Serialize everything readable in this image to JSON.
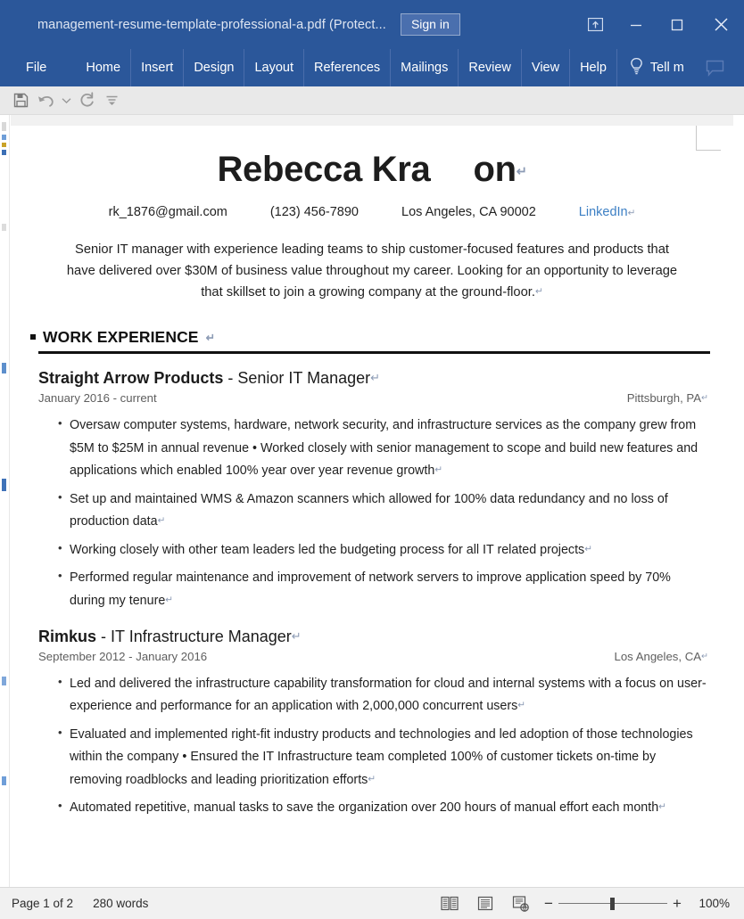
{
  "window": {
    "title": "management-resume-template-professional-a.pdf (Protect...",
    "sign_in_label": "Sign in",
    "accent_color": "#2b579a",
    "controls": {
      "ribbon_display_options": "ribbon-display-options-icon",
      "minimize": "minimize-icon",
      "maximize": "maximize-icon",
      "close": "close-icon"
    }
  },
  "ribbon": {
    "tabs": [
      {
        "label": "File"
      },
      {
        "label": "Home"
      },
      {
        "label": "Insert"
      },
      {
        "label": "Design"
      },
      {
        "label": "Layout"
      },
      {
        "label": "References"
      },
      {
        "label": "Mailings"
      },
      {
        "label": "Review"
      },
      {
        "label": "View"
      },
      {
        "label": "Help"
      }
    ],
    "tell_me": "Tell m",
    "tell_me_icon": "lightbulb-icon",
    "comments_icon": "comment-icon"
  },
  "quick_access": {
    "buttons": [
      {
        "name": "save-button",
        "icon": "save-icon"
      },
      {
        "name": "undo-button",
        "icon": "undo-icon"
      },
      {
        "name": "undo-dropdown-button",
        "icon": "chevron-down-icon"
      },
      {
        "name": "redo-button",
        "icon": "redo-icon"
      },
      {
        "name": "customize-quick-access-toolbar-button",
        "icon": "customize-qat-icon"
      }
    ]
  },
  "document": {
    "name_part1": "Rebecca Kra",
    "name_part2": "on",
    "contact": {
      "email": "rk_1876@gmail.com",
      "phone": "(123) 456-7890",
      "location": "Los Angeles, CA 90002",
      "link": "LinkedIn"
    },
    "summary": "Senior IT manager with experience leading teams to ship customer-focused features and products that have delivered over $30M of business value throughout my career. Looking for an opportunity to leverage that skillset to join a growing company at the ground-floor.",
    "section_heading": "WORK EXPERIENCE",
    "jobs": [
      {
        "company": "Straight Arrow Products",
        "separator": " - ",
        "role": "Senior IT Manager",
        "dates": "January 2016 - current",
        "location": "Pittsburgh, PA",
        "bullets": [
          "Oversaw computer systems, hardware, network security, and infrastructure services as the company grew from $5M to $25M in annual revenue • Worked closely with senior management to scope and build new features and applications which enabled 100% year over year revenue growth",
          "Set up and maintained WMS & Amazon scanners which allowed for 100% data redundancy and no loss of production data",
          "Working closely with other team leaders led the budgeting process for all IT related projects",
          "Performed regular maintenance and improvement of network servers to improve application speed by 70% during my tenure"
        ]
      },
      {
        "company": "Rimkus",
        "separator": " - ",
        "role": "IT Infrastructure Manager",
        "dates": "September 2012 - January 2016",
        "location": "Los Angeles, CA",
        "bullets": [
          "Led and delivered the infrastructure capability transformation for cloud and internal systems with a focus on user-experience and performance for an application with 2,000,000 concurrent users",
          "Evaluated and implemented right-fit industry products and technologies and led adoption of those technologies within the company • Ensured the IT Infrastructure team completed 100% of customer tickets on-time by removing roadblocks and leading prioritization efforts",
          "Automated repetitive, manual tasks to save the organization over 200 hours of manual effort each month"
        ]
      }
    ],
    "pilcrow": "↵",
    "bullet_glyph": "•"
  },
  "status_bar": {
    "page": "Page 1 of 2",
    "words": "280 words",
    "views": [
      {
        "name": "read-mode-view-button",
        "icon": "read-mode-icon"
      },
      {
        "name": "print-layout-view-button",
        "icon": "print-layout-icon"
      },
      {
        "name": "web-layout-view-button",
        "icon": "web-layout-icon"
      }
    ],
    "zoom_out": "−",
    "zoom_in": "+",
    "zoom_level": "100%"
  }
}
